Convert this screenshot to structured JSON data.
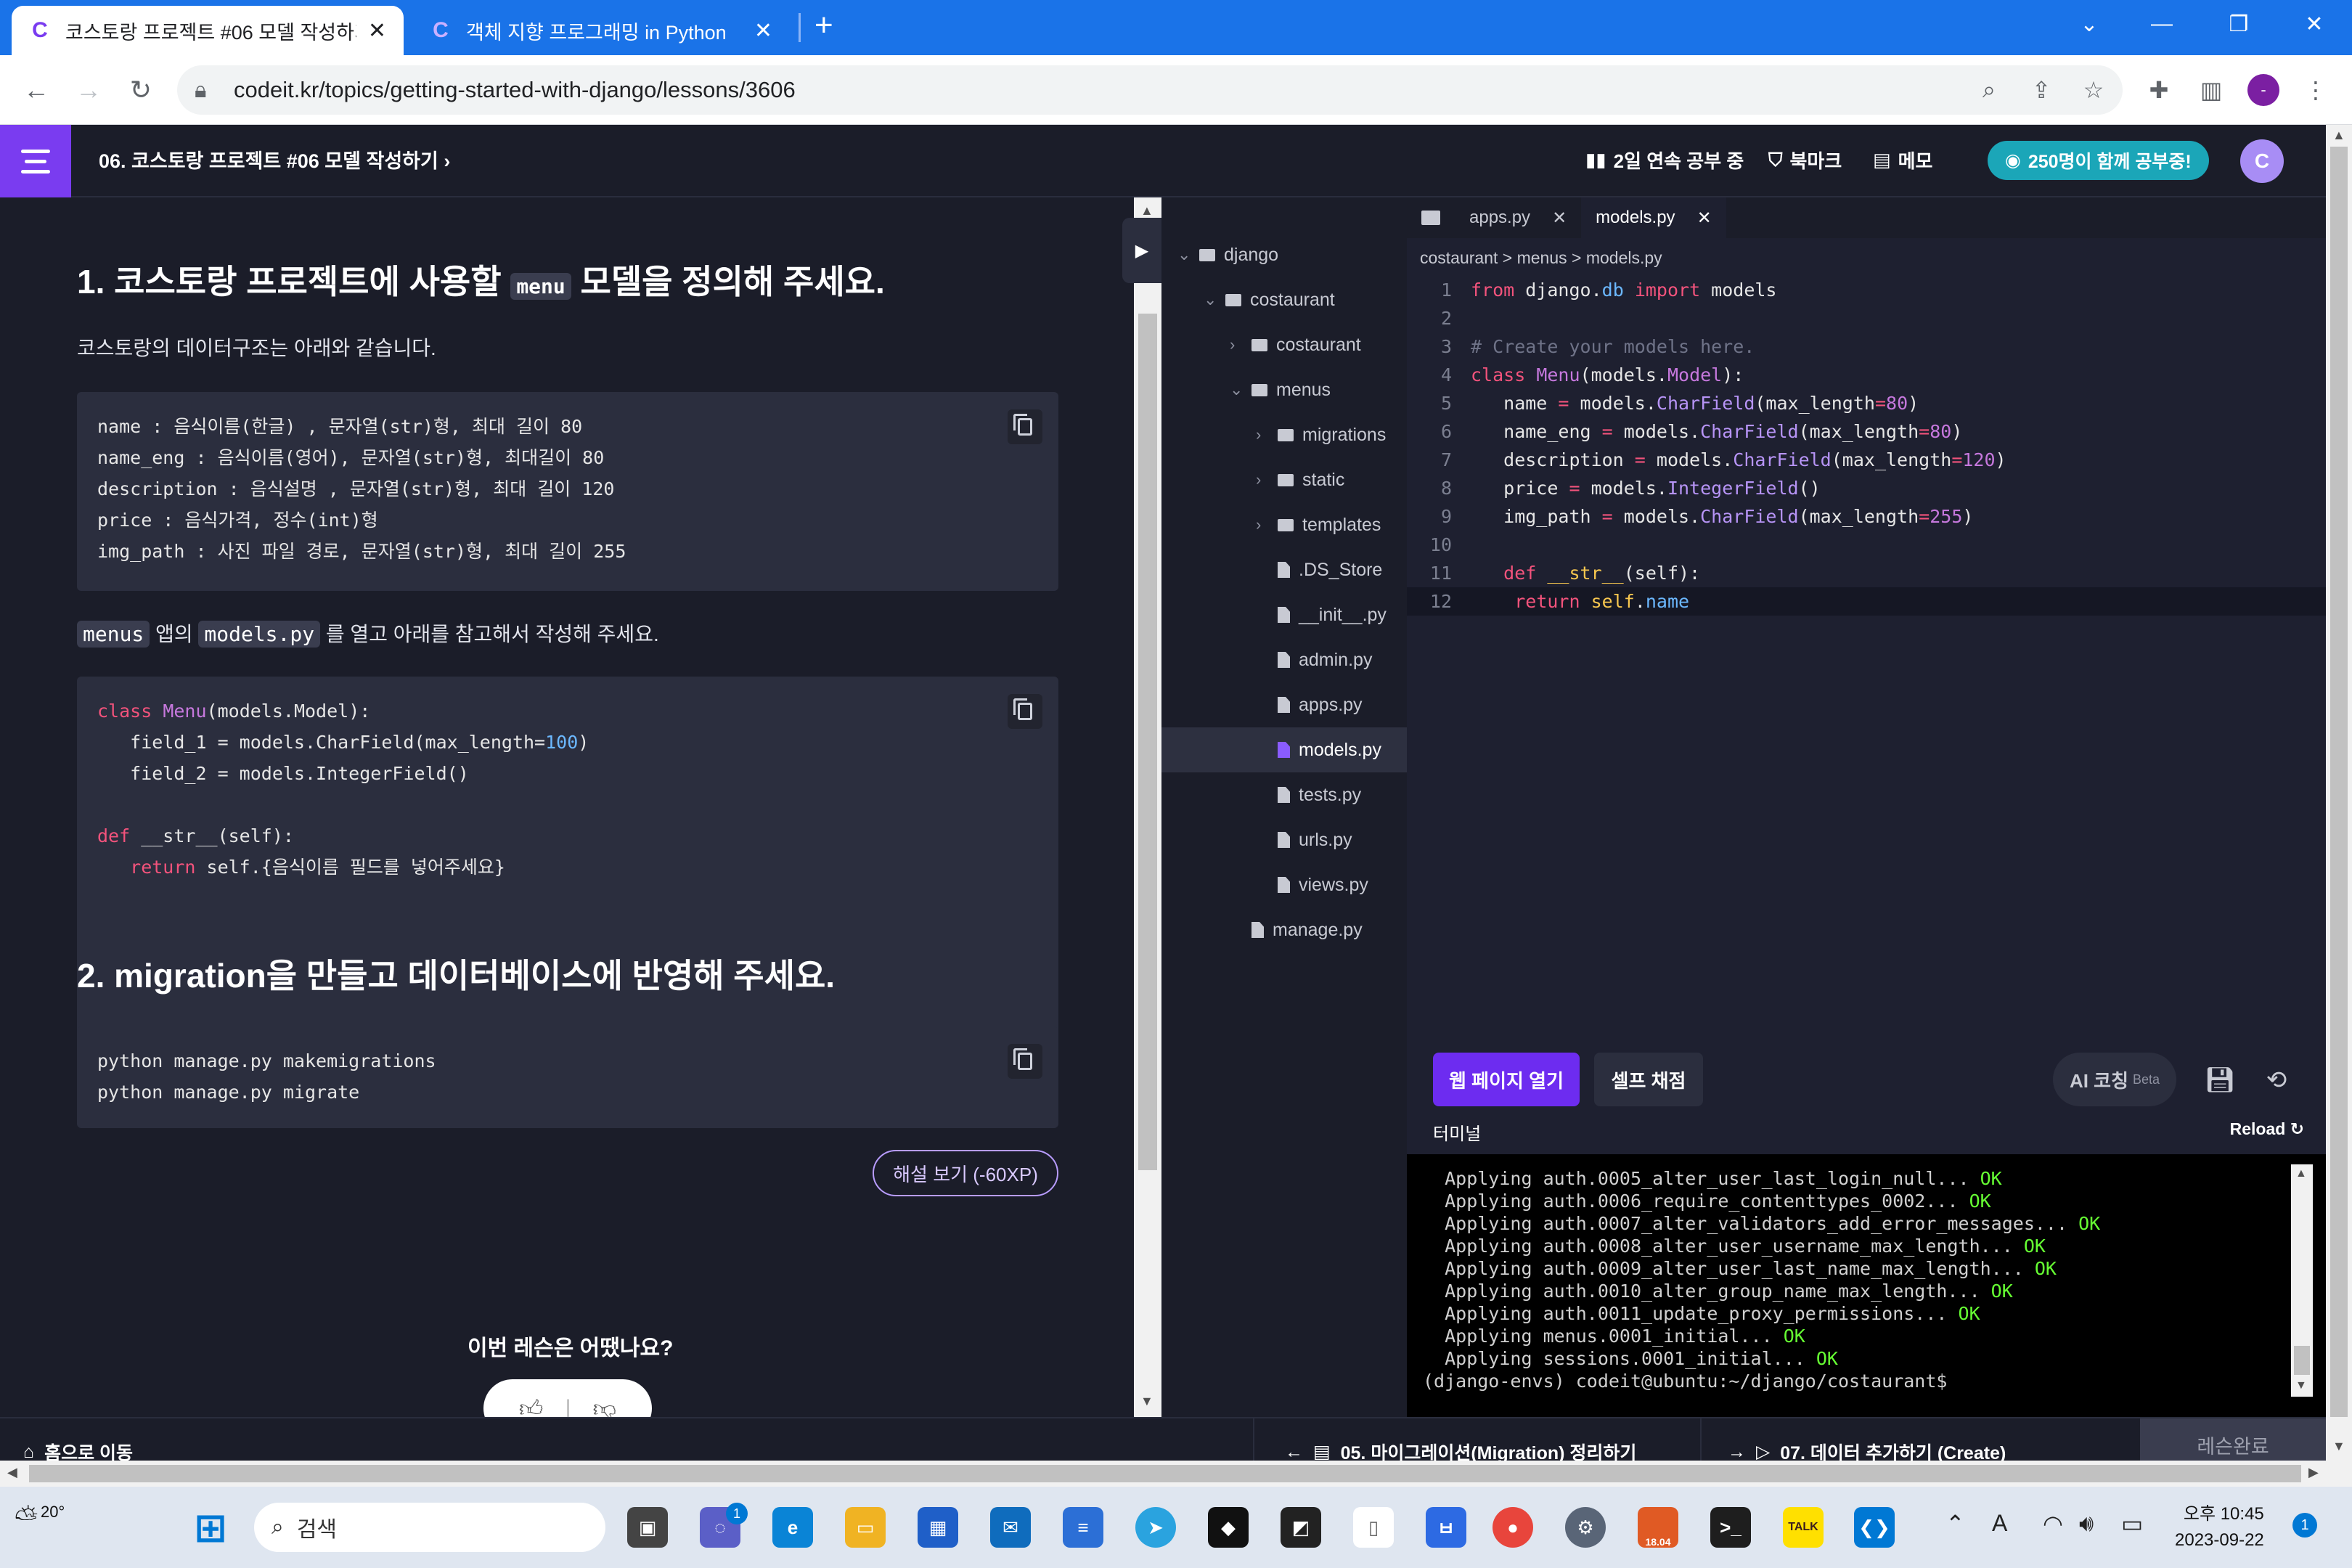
{
  "browser": {
    "tabs": [
      {
        "title": "코스토랑 프로젝트 #06 모델 작성하기",
        "active": true
      },
      {
        "title": "객체 지향 프로그래밍 in Python",
        "active": false
      }
    ],
    "url": "codeit.kr/topics/getting-started-with-django/lessons/3606",
    "profile_initial": "-"
  },
  "header": {
    "lesson_title": "06. 코스토랑 프로젝트 #06 모델 작성하기",
    "streak": "2일 연속 공부 중",
    "bookmark": "북마크",
    "memo": "메모",
    "study_badge": "250명이 함께 공부중!"
  },
  "content": {
    "step1_pre": "1. 코스토랑 프로젝트에 사용할",
    "step1_code": "menu",
    "step1_post": "모델을 정의해 주세요.",
    "desc": "코스토랑의 데이터구조는 아래와 같습니다.",
    "data_structure_lines": [
      "name : 음식이름(한글) , 문자열(str)형, 최대 길이 80",
      "name_eng : 음식이름(영어), 문자열(str)형, 최대길이 80",
      "description : 음식설명 , 문자열(str)형, 최대 길이 120",
      "price : 음식가격, 정수(int)형",
      "img_path : 사진 파일 경로, 문자열(str)형, 최대 길이 255"
    ],
    "instr_code1": "menus",
    "instr_mid": "앱의",
    "instr_code2": "models.py",
    "instr_post": "를 열고 아래를 참고해서 작성해 주세요.",
    "sample": {
      "l1_kw": "class",
      "l1_cls": "Menu",
      "l1_rest": "(models.Model):",
      "l2_pre": "   field_1 = models.CharField(max_length=",
      "l2_num": "100",
      "l2_post": ")",
      "l3": "   field_2 = models.IntegerField()",
      "l5_kw": "def",
      "l5_rest": " __str__(self):",
      "l6_kw": "return",
      "l6_rest": " self.{음식이름 필드를 넣어주세요}"
    },
    "step2": "2. migration을 만들고 데이터베이스에 반영해 주세요.",
    "commands": [
      "python manage.py makemigrations",
      "python manage.py migrate"
    ],
    "explain_btn": "해설 보기 (-60XP)",
    "feedback_q": "이번 레슨은 어땠나요?"
  },
  "tree": [
    {
      "label": "django",
      "type": "folder",
      "depth": 0,
      "open": true
    },
    {
      "label": "costaurant",
      "type": "folder",
      "depth": 1,
      "open": true
    },
    {
      "label": "costaurant",
      "type": "folder",
      "depth": 2,
      "open": false
    },
    {
      "label": "menus",
      "type": "folder",
      "depth": 2,
      "open": true
    },
    {
      "label": "migrations",
      "type": "folder",
      "depth": 3,
      "open": false
    },
    {
      "label": "static",
      "type": "folder",
      "depth": 3,
      "open": false
    },
    {
      "label": "templates",
      "type": "folder",
      "depth": 3,
      "open": false
    },
    {
      "label": ".DS_Store",
      "type": "file",
      "depth": 3
    },
    {
      "label": "__init__.py",
      "type": "file",
      "depth": 3
    },
    {
      "label": "admin.py",
      "type": "file",
      "depth": 3
    },
    {
      "label": "apps.py",
      "type": "file",
      "depth": 3
    },
    {
      "label": "models.py",
      "type": "file",
      "depth": 3,
      "selected": true
    },
    {
      "label": "tests.py",
      "type": "file",
      "depth": 3
    },
    {
      "label": "urls.py",
      "type": "file",
      "depth": 3
    },
    {
      "label": "views.py",
      "type": "file",
      "depth": 3
    },
    {
      "label": "manage.py",
      "type": "file",
      "depth": 2
    }
  ],
  "editor": {
    "tabs": [
      "apps.py",
      "models.py"
    ],
    "breadcrumb": "costaurant > menus > models.py",
    "lines": [
      [
        [
          "c-kw",
          "from"
        ],
        [
          "tx",
          " django."
        ],
        [
          "c-mod",
          "db"
        ],
        [
          "tx",
          " "
        ],
        [
          "c-kw",
          "import"
        ],
        [
          "tx",
          " models"
        ]
      ],
      [],
      [
        [
          "c-com",
          "# Create your models here."
        ]
      ],
      [
        [
          "c-kw",
          "class"
        ],
        [
          "tx",
          " "
        ],
        [
          "c-cls",
          "Menu"
        ],
        [
          "tx",
          "(models."
        ],
        [
          "c-cls",
          "Model"
        ],
        [
          "tx",
          "):"
        ]
      ],
      [
        [
          "tx",
          "   name "
        ],
        [
          "c-kw",
          "="
        ],
        [
          "tx",
          " models."
        ],
        [
          "c-fn",
          "CharField"
        ],
        [
          "tx",
          "(max_length"
        ],
        [
          "c-kw",
          "="
        ],
        [
          "c-num",
          "80"
        ],
        [
          "tx",
          ")"
        ]
      ],
      [
        [
          "tx",
          "   name_eng "
        ],
        [
          "c-kw",
          "="
        ],
        [
          "tx",
          " models."
        ],
        [
          "c-fn",
          "CharField"
        ],
        [
          "tx",
          "(max_length"
        ],
        [
          "c-kw",
          "="
        ],
        [
          "c-num",
          "80"
        ],
        [
          "tx",
          ")"
        ]
      ],
      [
        [
          "tx",
          "   description "
        ],
        [
          "c-kw",
          "="
        ],
        [
          "tx",
          " models."
        ],
        [
          "c-fn",
          "CharField"
        ],
        [
          "tx",
          "(max_length"
        ],
        [
          "c-kw",
          "="
        ],
        [
          "c-num",
          "120"
        ],
        [
          "tx",
          ")"
        ]
      ],
      [
        [
          "tx",
          "   price "
        ],
        [
          "c-kw",
          "="
        ],
        [
          "tx",
          " models."
        ],
        [
          "c-fn",
          "IntegerField"
        ],
        [
          "tx",
          "()"
        ]
      ],
      [
        [
          "tx",
          "   img_path "
        ],
        [
          "c-kw",
          "="
        ],
        [
          "tx",
          " models."
        ],
        [
          "c-fn",
          "CharField"
        ],
        [
          "tx",
          "(max_length"
        ],
        [
          "c-kw",
          "="
        ],
        [
          "c-num",
          "255"
        ],
        [
          "tx",
          ")"
        ]
      ],
      [],
      [
        [
          "tx",
          "   "
        ],
        [
          "c-kw",
          "def"
        ],
        [
          "tx",
          " "
        ],
        [
          "c-self",
          "__str__"
        ],
        [
          "tx",
          "(self):"
        ]
      ],
      [
        [
          "tx",
          "    "
        ],
        [
          "c-kw",
          "return"
        ],
        [
          "tx",
          " "
        ],
        [
          "c-self",
          "self"
        ],
        [
          "tx",
          "."
        ],
        [
          "c-mod",
          "name"
        ]
      ]
    ],
    "open_web": "웹 페이지 열기",
    "self_grade": "셀프 채점",
    "ai_coach": "AI 코칭",
    "ai_beta": "Beta",
    "terminal_label": "터미널",
    "reload": "Reload",
    "terminal_lines": [
      [
        "  Applying auth.0005_alter_user_last_login_null... ",
        "OK"
      ],
      [
        "  Applying auth.0006_require_contenttypes_0002... ",
        "OK"
      ],
      [
        "  Applying auth.0007_alter_validators_add_error_messages... ",
        "OK"
      ],
      [
        "  Applying auth.0008_alter_user_username_max_length... ",
        "OK"
      ],
      [
        "  Applying auth.0009_alter_user_last_name_max_length... ",
        "OK"
      ],
      [
        "  Applying auth.0010_alter_group_name_max_length... ",
        "OK"
      ],
      [
        "  Applying auth.0011_update_proxy_permissions... ",
        "OK"
      ],
      [
        "  Applying menus.0001_initial... ",
        "OK"
      ],
      [
        "  Applying sessions.0001_initial... ",
        "OK"
      ],
      [
        "(django-envs) codeit@ubuntu:~/django/costaurant$",
        ""
      ]
    ]
  },
  "bottom": {
    "home": "홈으로 이동",
    "prev": "05. 마이그레이션(Migration) 정리하기",
    "next": "07. 데이터 추가하기 (Create)",
    "complete": "레슨완료"
  },
  "taskbar": {
    "temp": "20°",
    "search": "검색",
    "chat_badge": "1",
    "calendar_label": "18.04",
    "talk_label": "TALK",
    "time": "오후 10:45",
    "date": "2023-09-22",
    "notif": "1"
  }
}
